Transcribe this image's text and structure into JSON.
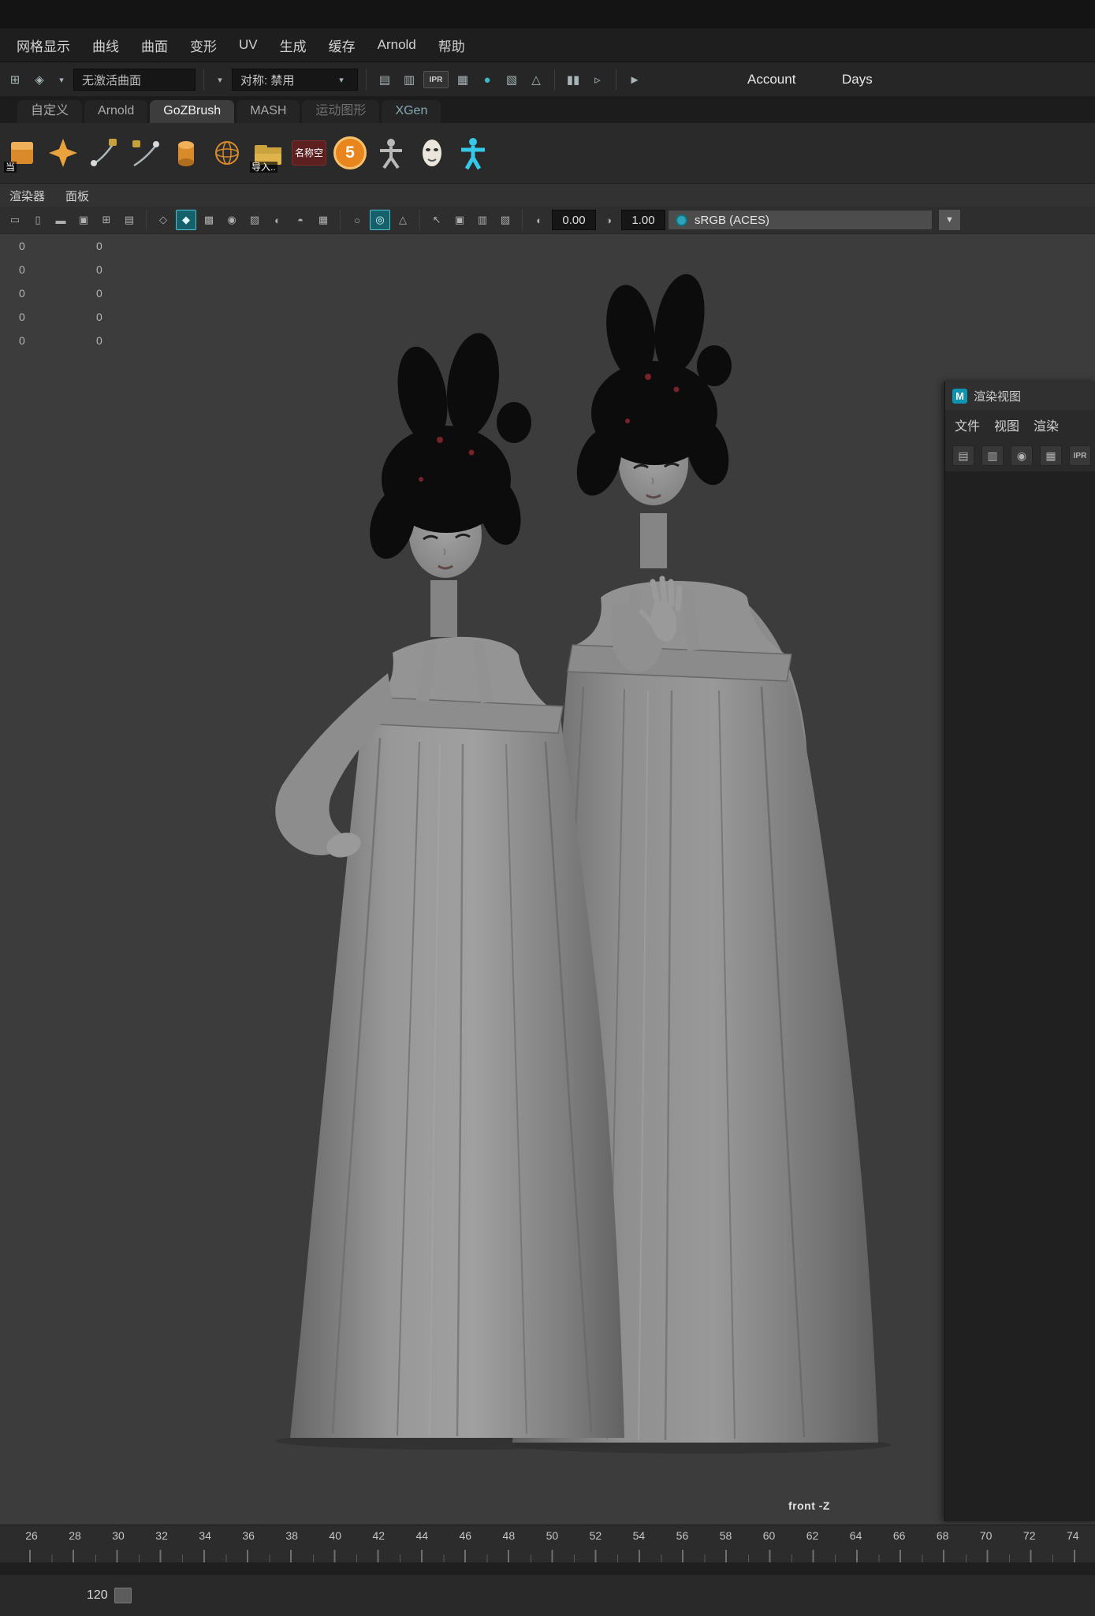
{
  "menubar": {
    "items": [
      "网格显示",
      "曲线",
      "曲面",
      "变形",
      "UV",
      "生成",
      "缓存",
      "Arnold",
      "帮助"
    ]
  },
  "statusline": {
    "surface_field": "无激活曲面",
    "symmetry_label": "对称: 禁用",
    "account_label": "Account",
    "days_label": "Days"
  },
  "shelf": {
    "tabs": [
      "自定义",
      "Arnold",
      "GoZBrush",
      "MASH",
      "运动图形",
      "XGen"
    ],
    "active_tab": "GoZBrush",
    "labels": {
      "first": "当",
      "import": "导入..",
      "namespace": "名称空",
      "five": "5"
    }
  },
  "panelbar": {
    "items": [
      "渲染器",
      "面板"
    ]
  },
  "viewport_bar": {
    "exposure": "0.00",
    "gamma": "1.00",
    "colorspace": "sRGB (ACES)"
  },
  "hud": {
    "values": [
      "0",
      "0",
      "0",
      "0",
      "0",
      "0",
      "0",
      "0",
      "0",
      "0"
    ]
  },
  "viewport": {
    "camera_label": "front -Z"
  },
  "render_view": {
    "title": "渲染视图",
    "menus": [
      "文件",
      "视图",
      "渲染"
    ]
  },
  "timeline": {
    "labels": [
      "26",
      "28",
      "30",
      "32",
      "34",
      "36",
      "38",
      "40",
      "42",
      "44",
      "46",
      "48",
      "50",
      "52",
      "54",
      "56",
      "58",
      "60",
      "62",
      "64",
      "66",
      "68",
      "70",
      "72",
      "74"
    ]
  },
  "range_bar": {
    "end_frame": "120"
  },
  "colors": {
    "accent_cyan": "#3fb6c4",
    "maya_orange": "#e8a33d",
    "viewport_bg": "#3c3c3c",
    "hair_pin_red": "#77232a"
  },
  "icons": {
    "snap_grid": "⊞",
    "snap_curve": "◈",
    "tri_down": "▾",
    "render_frame": "▤",
    "render_region": "▥",
    "ipr_label": "IPR",
    "render_settings": "▦",
    "render_sphere": "●",
    "hypershade": "▧",
    "light": "△",
    "pause": "▮▮",
    "play": "►",
    "step": "▹",
    "chevron_down": "▼",
    "grid": "⊞",
    "film_gate": "▭",
    "res_gate": "▯",
    "gate_mask": "▬",
    "safe_area": "▣",
    "cam_attrs": "▤",
    "wireframe": "◇",
    "smooth_shade": "◆",
    "textured": "▩",
    "use_lights": "◉",
    "shadows": "▨",
    "ao": "◐",
    "mblur": "◓",
    "aa": "▦",
    "isolate": "○",
    "xray": "◎",
    "select_arrow": "↖",
    "panel_a": "▣",
    "panel_b": "▥",
    "panel_c": "▧",
    "exposure": "◐",
    "gamma": "◑",
    "rv_render": "▤",
    "rv_region": "▥",
    "rv_snapshot": "◉",
    "rv_options": "▦"
  }
}
